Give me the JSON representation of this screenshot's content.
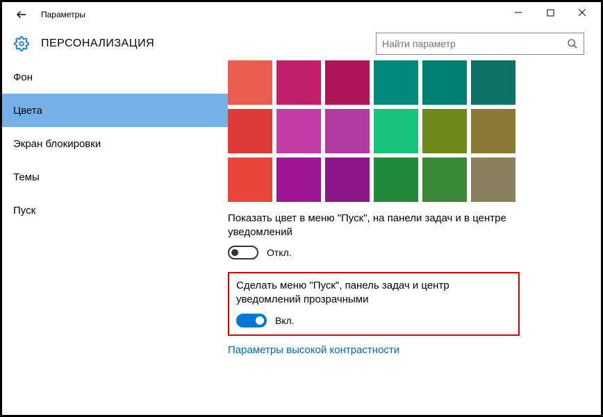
{
  "titlebar": {
    "title": "Параметры"
  },
  "header": {
    "title": "ПЕРСОНАЛИЗАЦИЯ",
    "search_placeholder": "Найти параметр"
  },
  "sidebar": {
    "items": [
      {
        "label": "Фон"
      },
      {
        "label": "Цвета"
      },
      {
        "label": "Экран блокировки"
      },
      {
        "label": "Темы"
      },
      {
        "label": "Пуск"
      }
    ],
    "active_index": 1
  },
  "colors": {
    "swatches": [
      "#e95c4e",
      "#c21f6b",
      "#b01657",
      "#008a7c",
      "#008072",
      "#0e7366",
      "#dd3a3a",
      "#c23ea6",
      "#b13ba0",
      "#18c47a",
      "#6e8a1a",
      "#8a7a36",
      "#e8463a",
      "#9e1696",
      "#8a168a",
      "#1f8a3b",
      "#3a8a3a",
      "#8a7f5e"
    ]
  },
  "settings": {
    "show_color_label": "Показать цвет в меню \"Пуск\", на панели задач и в центре уведомлений",
    "show_color_state": "Откл.",
    "transparency_label": "Сделать меню \"Пуск\", панель задач и центр уведомлений прозрачными",
    "transparency_state": "Вкл.",
    "contrast_link": "Параметры высокой контрастности"
  }
}
